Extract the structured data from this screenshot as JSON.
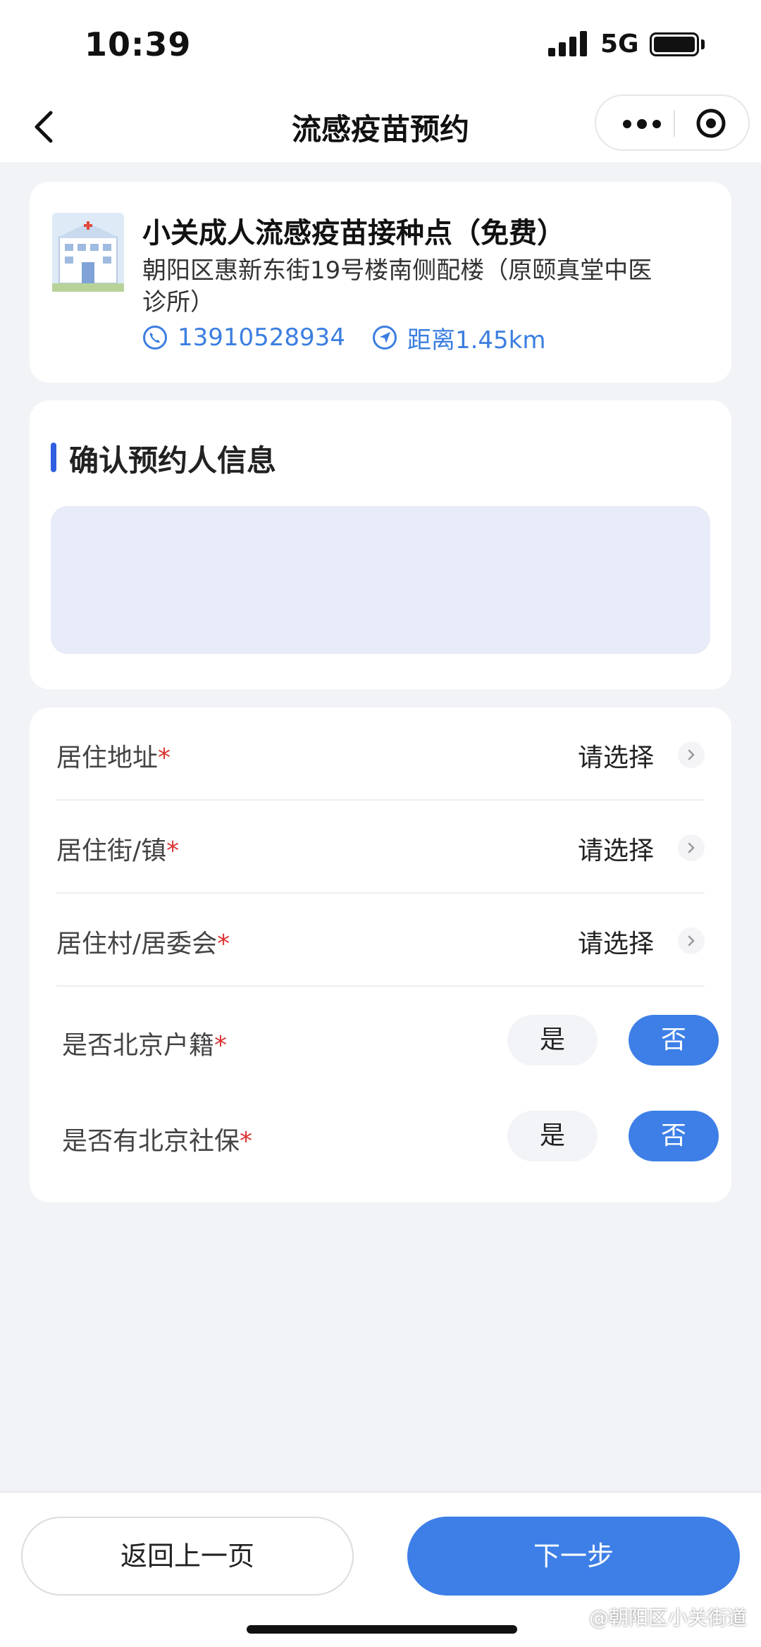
{
  "status_bar": {
    "time": "10:39",
    "network": "5G"
  },
  "nav": {
    "title": "流感疫苗预约"
  },
  "clinic": {
    "name": "小关成人流感疫苗接种点（免费）",
    "address": "朝阳区惠新东街19号楼南侧配楼（原颐真堂中医诊所）",
    "phone": "13910528934",
    "distance": "距离1.45km"
  },
  "section": {
    "title": "确认预约人信息"
  },
  "form": {
    "rows": [
      {
        "label": "居住地址",
        "value": "请选择"
      },
      {
        "label": "居住街/镇",
        "value": "请选择"
      },
      {
        "label": "居住村/居委会",
        "value": "请选择"
      }
    ],
    "toggles": [
      {
        "label": "是否北京户籍",
        "yes": "是",
        "no": "否",
        "selected": "否"
      },
      {
        "label": "是否有北京社保",
        "yes": "是",
        "no": "否",
        "selected": "否"
      }
    ],
    "required_mark": "*"
  },
  "footer": {
    "back_label": "返回上一页",
    "next_label": "下一步",
    "watermark": "@朝阳区小关街道"
  },
  "colors": {
    "accent": "#3d7fe6",
    "section_bar": "#2f5fe0",
    "required": "#dd3333",
    "link": "#3b7ee0"
  },
  "icons": [
    "back-arrow-icon",
    "more-dots-icon",
    "target-icon",
    "hospital-icon",
    "phone-icon",
    "location-arrow-icon",
    "chevron-right-icon"
  ]
}
